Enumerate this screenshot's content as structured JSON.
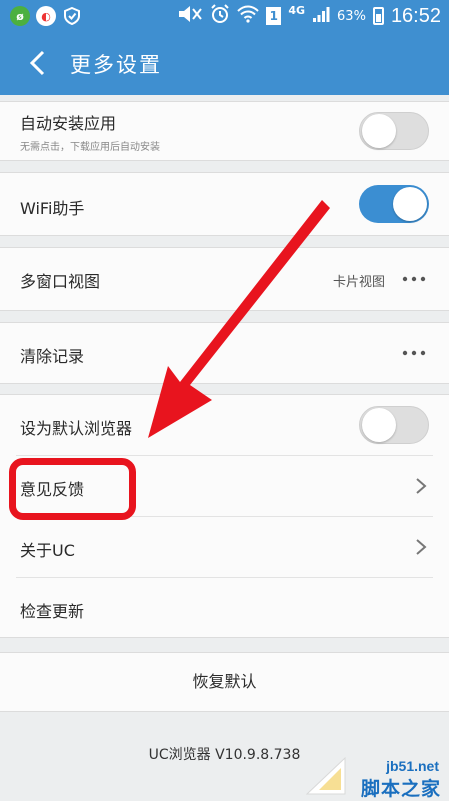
{
  "status_bar": {
    "signal_type": "4G",
    "sim_slot": "1",
    "battery": "63%",
    "time": "16:52",
    "icons": [
      "app-icon-green",
      "browser-icon",
      "shield-icon",
      "mute-icon",
      "alarm-icon",
      "wifi-icon",
      "sim-icon",
      "signal-icon",
      "battery-icon"
    ]
  },
  "header": {
    "title": "更多设置"
  },
  "settings": {
    "auto_install": {
      "label": "自动安装应用",
      "sub": "无需点击，下载应用后自动安装",
      "enabled": false
    },
    "wifi_helper": {
      "label": "WiFi助手",
      "enabled": true
    },
    "multi_window": {
      "label": "多窗口视图",
      "value": "卡片视图"
    },
    "clear_records": {
      "label": "清除记录"
    },
    "default_browser": {
      "label": "设为默认浏览器",
      "enabled": false
    },
    "feedback": {
      "label": "意见反馈"
    },
    "about": {
      "label": "关于UC"
    },
    "check_update": {
      "label": "检查更新"
    }
  },
  "restore_defaults": {
    "label": "恢复默认"
  },
  "version": {
    "text": "UC浏览器 V10.9.8.738"
  },
  "watermark": {
    "site": "jb51.net",
    "name": "脚本之家"
  },
  "colors": {
    "accent": "#3f8fd0",
    "toggle_on": "#3b8ed2",
    "annotation": "#e8141e",
    "background": "#eceeef"
  }
}
